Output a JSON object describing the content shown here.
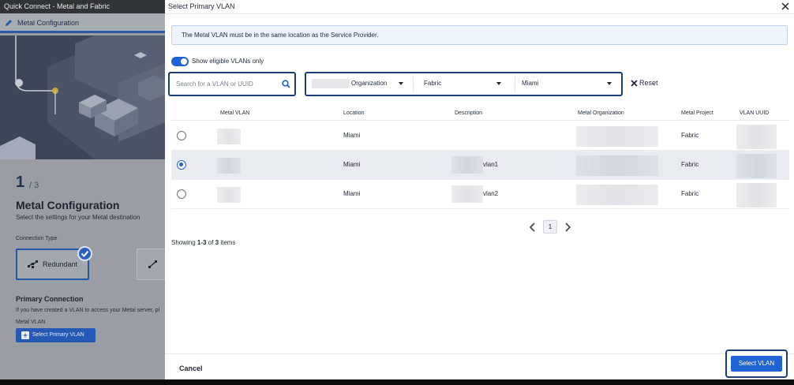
{
  "background_app": {
    "title": "Quick Connect - Metal and Fabric",
    "tab_label": "Metal Configuration",
    "step_current": "1",
    "step_total": "/ 3",
    "heading": "Metal Configuration",
    "subheading": "Select the settings for your Metal destination",
    "connection_type_label": "Connection Type",
    "connection_card_label": "Redundant",
    "primary_connection_label": "Primary Connection",
    "help_text": "If you have created a VLAN to access your Metal server, pl",
    "metal_vlan_label": "Metal VLAN",
    "select_primary_vlan_button": "Select Primary VLAN"
  },
  "modal": {
    "title": "Select Primary VLAN",
    "info_banner": "The Metal VLAN must be in the same location as the Service Provider.",
    "toggle_label": "Show eligible VLANs only",
    "toggle_on": true,
    "search_placeholder": "Search for a VLAN or UUID",
    "filters": {
      "organization": "Organization",
      "project": "Fabric",
      "location": "Miami"
    },
    "reset_label": "Reset",
    "table": {
      "columns": [
        "Metal VLAN",
        "Location",
        "Description",
        "Metal Organization",
        "Metal Project",
        "VLAN UUID"
      ],
      "rows": [
        {
          "location": "Miami",
          "description": "",
          "project": "Fabric",
          "selected": false
        },
        {
          "location": "Miami",
          "description": "vlan1",
          "project": "Fabric",
          "selected": true
        },
        {
          "location": "Miami",
          "description": "vlan2",
          "project": "Fabric",
          "selected": false
        }
      ]
    },
    "pagination": {
      "current_page": "1"
    },
    "showing": {
      "prefix": "Showing",
      "range": "1-3",
      "of": "of",
      "total": "3",
      "suffix": "items"
    },
    "cancel_label": "Cancel",
    "select_vlan_label": "Select VLAN"
  },
  "colors": {
    "accent": "#1f63d6",
    "focus_outline": "#1a3d78",
    "banner_bg": "#eef4fc",
    "selected_row_bg": "#e8ebf0"
  }
}
